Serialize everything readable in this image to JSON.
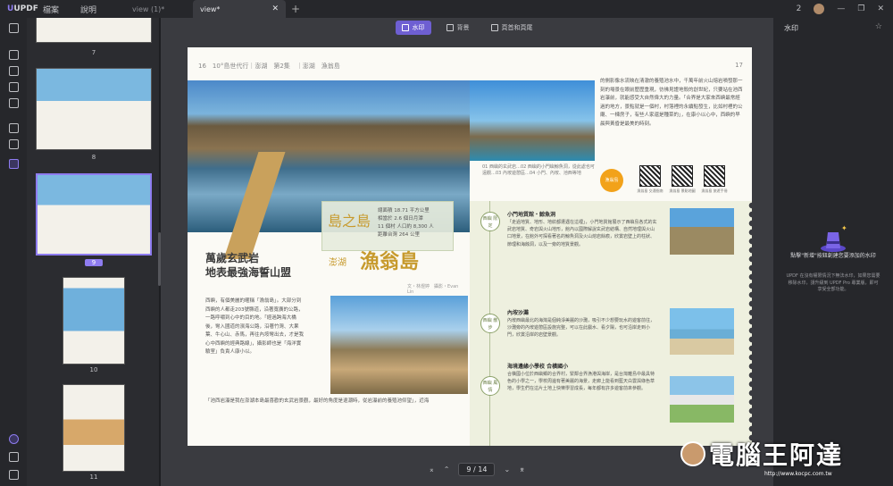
{
  "app": {
    "logo": "UPDF",
    "menu": [
      "檔案",
      "說明"
    ]
  },
  "tabs": [
    {
      "label": "view (1)*"
    },
    {
      "label": "view*"
    }
  ],
  "topbar": {
    "page_count": "2"
  },
  "thumbnails": {
    "labels": [
      "7",
      "8",
      "9",
      "10",
      "11"
    ],
    "selected": "9"
  },
  "toolbar": {
    "watermark": "水印",
    "background": "背景",
    "header_footer": "頁首和頁尾"
  },
  "page": {
    "header_left": "16　10°島世代行｜澎湖　第2集　｜澎湖　漁翁島",
    "header_right": "17",
    "title_left_1": "萬歲玄武岩",
    "title_left_2": "地表最強海誓山盟",
    "title_sub": "澎湖",
    "title_main": "漁翁島",
    "byline": "文・林煜婷　攝影・Evan Lin",
    "infobox_big": "島之島",
    "infobox_stats": [
      "總面積 18.71 平方公里",
      "相當於 2.6 個日月潭",
      "11 個村 人口約 8,300 人",
      "距離台灣 264 公里"
    ],
    "caption_top": "01 西嶼的玄武岩…02 西嶼的小門嶼鯨魚洞，從此處也可遠觀…03 內垵遊憩區…04 小門、內垵、池西等地",
    "body1": "西嶼，有個美麗的暱稱「漁翁島」。大部分到西嶼的人都走203號縣道，沿著寬廣的公路，一路呼嘯到心中的目的地。「經過跨海大橋後，彎入國道的濱海公路，沿著竹灣、大果葉、牛心山、赤馬，再往內垵彎出去，才是我心中西嶼的經典路線」，攝影師也是「海洋實驗室」負責人康小以。",
    "body2": "「池西岩瀑是我在澎湖本島最喜歡的玄武岩景觀，最好的角度是退潮時，從岩瀑前的養殖池仰望」，近海",
    "right_top": "的側影像水流映在清澈的養殖池水中，千萬年前火山熔岩噴發那一刻的場景在眼前歷歷重現，彷彿見證地殼的創世紀，只要站在池西岩瀑前，就能感受大自然偉大的力量。「合界是大家來西嶼最常經過的地方，景點就是一個村，村落裡的永續點發生，比如村裡的公廟、一棟房子，有些人家還是種菜的」，在康小以心中，西嶼的早晨與黃昏是最美的時刻。",
    "badge": "漁翁島 INFO",
    "qr_labels": [
      "漁翁島 交通指南",
      "漁翁島 景點地圖",
      "漁翁島 旅遊手冊"
    ],
    "sections": [
      {
        "tag": "西嶼 限定",
        "title": "小門地質館・鯨魚洞",
        "body": "「走過地質、地形、地紋都遭遇在這裡」，小門地質館展示了西嶼島各式的玄武岩地質、奇岩與火山地形，館內以國際解說玄武岩結構、自然地理與火山口地景，在館外可探看著名的鯨魚洞及火山熔岩餘痕，欣賞岩壁上的柱狀、節理和海蝕洞，以及一旁的地質景觀。"
      },
      {
        "tag": "西嶼 散步",
        "title": "內垵沙灘",
        "body": "內垵西嶼最北的海灣是個純淨美麗的沙灘，吸引不少想要玩水的遊客前往，沙灘旁的內垵遊憩區設施完整，可以在此戲水、看夕陽，也可沿岸走到小門，欣賞沿岸的岩壁景觀。"
      },
      {
        "tag": "西嶼 風情",
        "title": "海境邊緣小學校 合橫國小",
        "body": "合橫國小位於西嶼鄉的合界村，緊鄰合界漁港與海岸，是台灣離島中最具特色的小學之一，學校周邊有著美麗的海景，走廊上能看到藍天白雲與綠色草地，學生們在這片土地上快樂學習成長，每年都有許多遊客前來參觀。"
      }
    ]
  },
  "pager": {
    "current": "9",
    "total": "14",
    "separator": "/"
  },
  "right_panel": {
    "title": "水印",
    "empty_title": "點擊\"新增\"按鈕創建您要添加的水印",
    "empty_desc": "UPDF 在沒有權限情況下無法水印，如果您需要移除水印，請升級到 UPDF Pro 專業版，即可享受全部功能。"
  },
  "watermark": {
    "text": "電腦王阿達",
    "url": "http://www.kocpc.com.tw"
  }
}
